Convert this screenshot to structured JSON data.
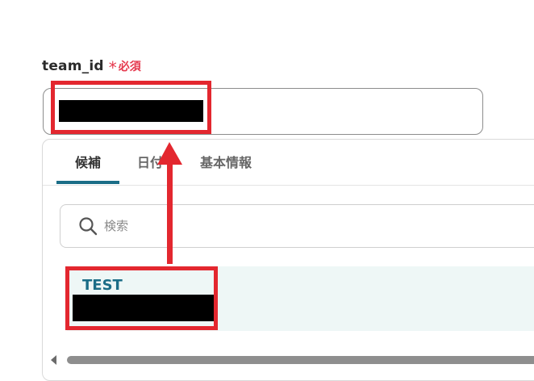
{
  "field": {
    "name": "team_id",
    "required_mark": "*",
    "required_label": "必須"
  },
  "tabs": [
    {
      "label": "候補",
      "active": true
    },
    {
      "label": "日付",
      "active": false
    },
    {
      "label": "基本情報",
      "active": false
    }
  ],
  "search": {
    "placeholder": "検索",
    "value": ""
  },
  "result": {
    "title": "TEST"
  },
  "annotation": {
    "highlight_color": "#e3272f",
    "arrow_icon": "arrow-up-icon"
  },
  "colors": {
    "accent": "#1b6d87",
    "required": "#e5384d",
    "result_bg": "#eef7f6"
  }
}
